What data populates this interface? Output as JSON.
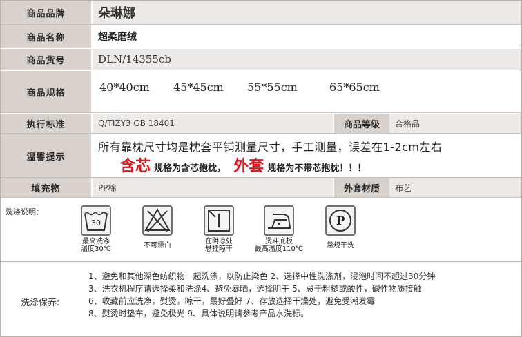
{
  "rows": {
    "brand": {
      "label": "商品品牌",
      "value": "朵琳娜"
    },
    "name": {
      "label": "商品名称",
      "value": "超柔磨绒"
    },
    "sku": {
      "label": "商品货号",
      "value": "DLN/14355cb"
    },
    "specs": {
      "label": "商品规格",
      "sizes": [
        "40*40cm",
        "45*45cm",
        "55*55cm",
        "65*65cm"
      ]
    },
    "standard": {
      "label": "执行标准",
      "value": "Q/TIZY3 GB 18401",
      "grade_label": "商品等级",
      "grade_value": "合格品"
    },
    "tips": {
      "label": "温馨提示",
      "line1": "所有靠枕尺寸均是枕套平铺测量尺寸，手工测量，误差在1-2cm左右",
      "core": "含芯",
      "core_text": "规格为含芯抱枕，",
      "cover": "外套",
      "cover_text": "规格为不带芯抱枕！！！"
    },
    "filling": {
      "label": "填充物",
      "value": "PP棉",
      "cover_label": "外套材质",
      "cover_value": "布艺"
    }
  },
  "wash": {
    "title": "洗涤说明：",
    "icons": [
      {
        "name": "wash-30-icon",
        "number": "30",
        "label1": "最高洗涤",
        "label2": "温度30℃"
      },
      {
        "name": "no-bleach-icon",
        "label1": "不可漂白",
        "label2": ""
      },
      {
        "name": "line-dry-shade-icon",
        "label1": "在阴凉处",
        "label2": "悬挂晾干"
      },
      {
        "name": "iron-low-icon",
        "label1": "烫斗底板",
        "label2": "最高温度110℃"
      },
      {
        "name": "dry-clean-p-icon",
        "letter": "P",
        "label1": "常规干洗",
        "label2": ""
      }
    ]
  },
  "care": {
    "title": "洗涤保养:",
    "lines": [
      "1、避免和其他深色纺织物一起洗涤，以防止染色 2、选择中性洗涤剂，浸泡时间不超过30分钟",
      "3、洗衣机程序请选择柔和洗涤4、避免暴晒，选择阴干 5、忌于粗糙或酸性，碱性物质接触",
      "6、收藏前应洗净，熨烫，晾干，最好叠好 7、存放选择干燥处，避免受潮发霉",
      "8、熨烫时垫布，避免极光 9、具体说明请参考产品水洗标。"
    ]
  },
  "colors": {
    "label_bg": "#d9d2cc",
    "accent_red": "#e8121a",
    "shade": "#eeeae7"
  }
}
